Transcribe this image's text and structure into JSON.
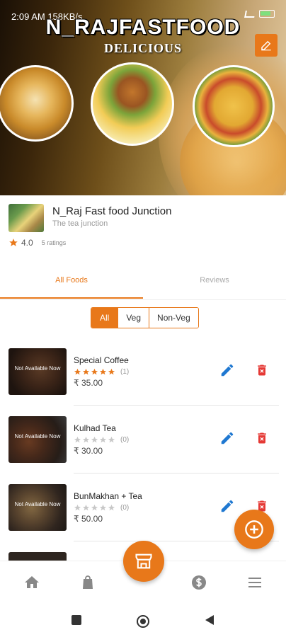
{
  "status_bar": {
    "time": "2:09 AM",
    "network_speed": "158KB/s"
  },
  "banner": {
    "title": "N_RAJFASTFOOD",
    "subtitle": "DELICIOUS"
  },
  "restaurant": {
    "name": "N_Raj Fast food Junction",
    "tagline": "The tea junction",
    "rating": "4.0",
    "ratings_count": "5 ratings"
  },
  "tabs": [
    {
      "label": "All Foods",
      "active": true
    },
    {
      "label": "Reviews",
      "active": false
    }
  ],
  "filters": [
    {
      "label": "All",
      "active": true
    },
    {
      "label": "Veg",
      "active": false
    },
    {
      "label": "Non-Veg",
      "active": false
    }
  ],
  "items": [
    {
      "name": "Special Coffee",
      "availability": "Not Available Now",
      "stars": 5,
      "rating_count": "(1)",
      "price": "₹ 35.00"
    },
    {
      "name": "Kulhad Tea",
      "availability": "Not Available Now",
      "stars": 0,
      "rating_count": "(0)",
      "price": "₹ 30.00"
    },
    {
      "name": "BunMakhan + Tea",
      "availability": "Not Available Now",
      "stars": 0,
      "rating_count": "(0)",
      "price": "₹ 50.00"
    }
  ],
  "colors": {
    "accent": "#e8781a",
    "edit_blue": "#1f78d1",
    "delete_red": "#e53935",
    "star_filled": "#e8781a",
    "star_empty": "#c8c8c8"
  },
  "icons": {
    "nav": [
      "home-icon",
      "shopping-bag-icon",
      "store-icon",
      "dollar-icon",
      "menu-icon"
    ],
    "actions": [
      "edit-pencil-icon",
      "delete-trash-icon",
      "add-circle-icon",
      "edit-cover-icon"
    ]
  }
}
